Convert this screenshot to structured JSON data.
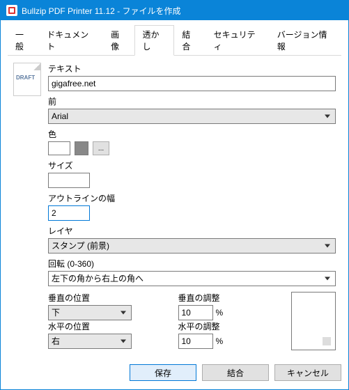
{
  "window": {
    "title": "Bullzip PDF Printer 11.12 - ファイルを作成"
  },
  "tabs": {
    "general": "一般",
    "document": "ドキュメント",
    "image": "画像",
    "watermark": "透かし",
    "merge": "結合",
    "security": "セキュリティ",
    "version": "バージョン情報"
  },
  "draft": {
    "label": "DRAFT"
  },
  "labels": {
    "text": "テキスト",
    "font": "前",
    "color": "色",
    "size": "サイズ",
    "outline": "アウトラインの幅",
    "layer": "レイヤ",
    "rotation": "回転 (0-360)",
    "vpos": "垂直の位置",
    "vadj": "垂直の調整",
    "hpos": "水平の位置",
    "hadj": "水平の調整",
    "percent": "%"
  },
  "values": {
    "text": "gigafree.net",
    "font": "Arial",
    "size": "",
    "outline": "2",
    "layer": "スタンプ (前景)",
    "rotation": "左下の角から右上の角へ",
    "vpos": "下",
    "vadj": "10",
    "hpos": "右",
    "hadj": "10"
  },
  "color_btn": "...",
  "buttons": {
    "save": "保存",
    "merge": "結合",
    "cancel": "キャンセル"
  }
}
